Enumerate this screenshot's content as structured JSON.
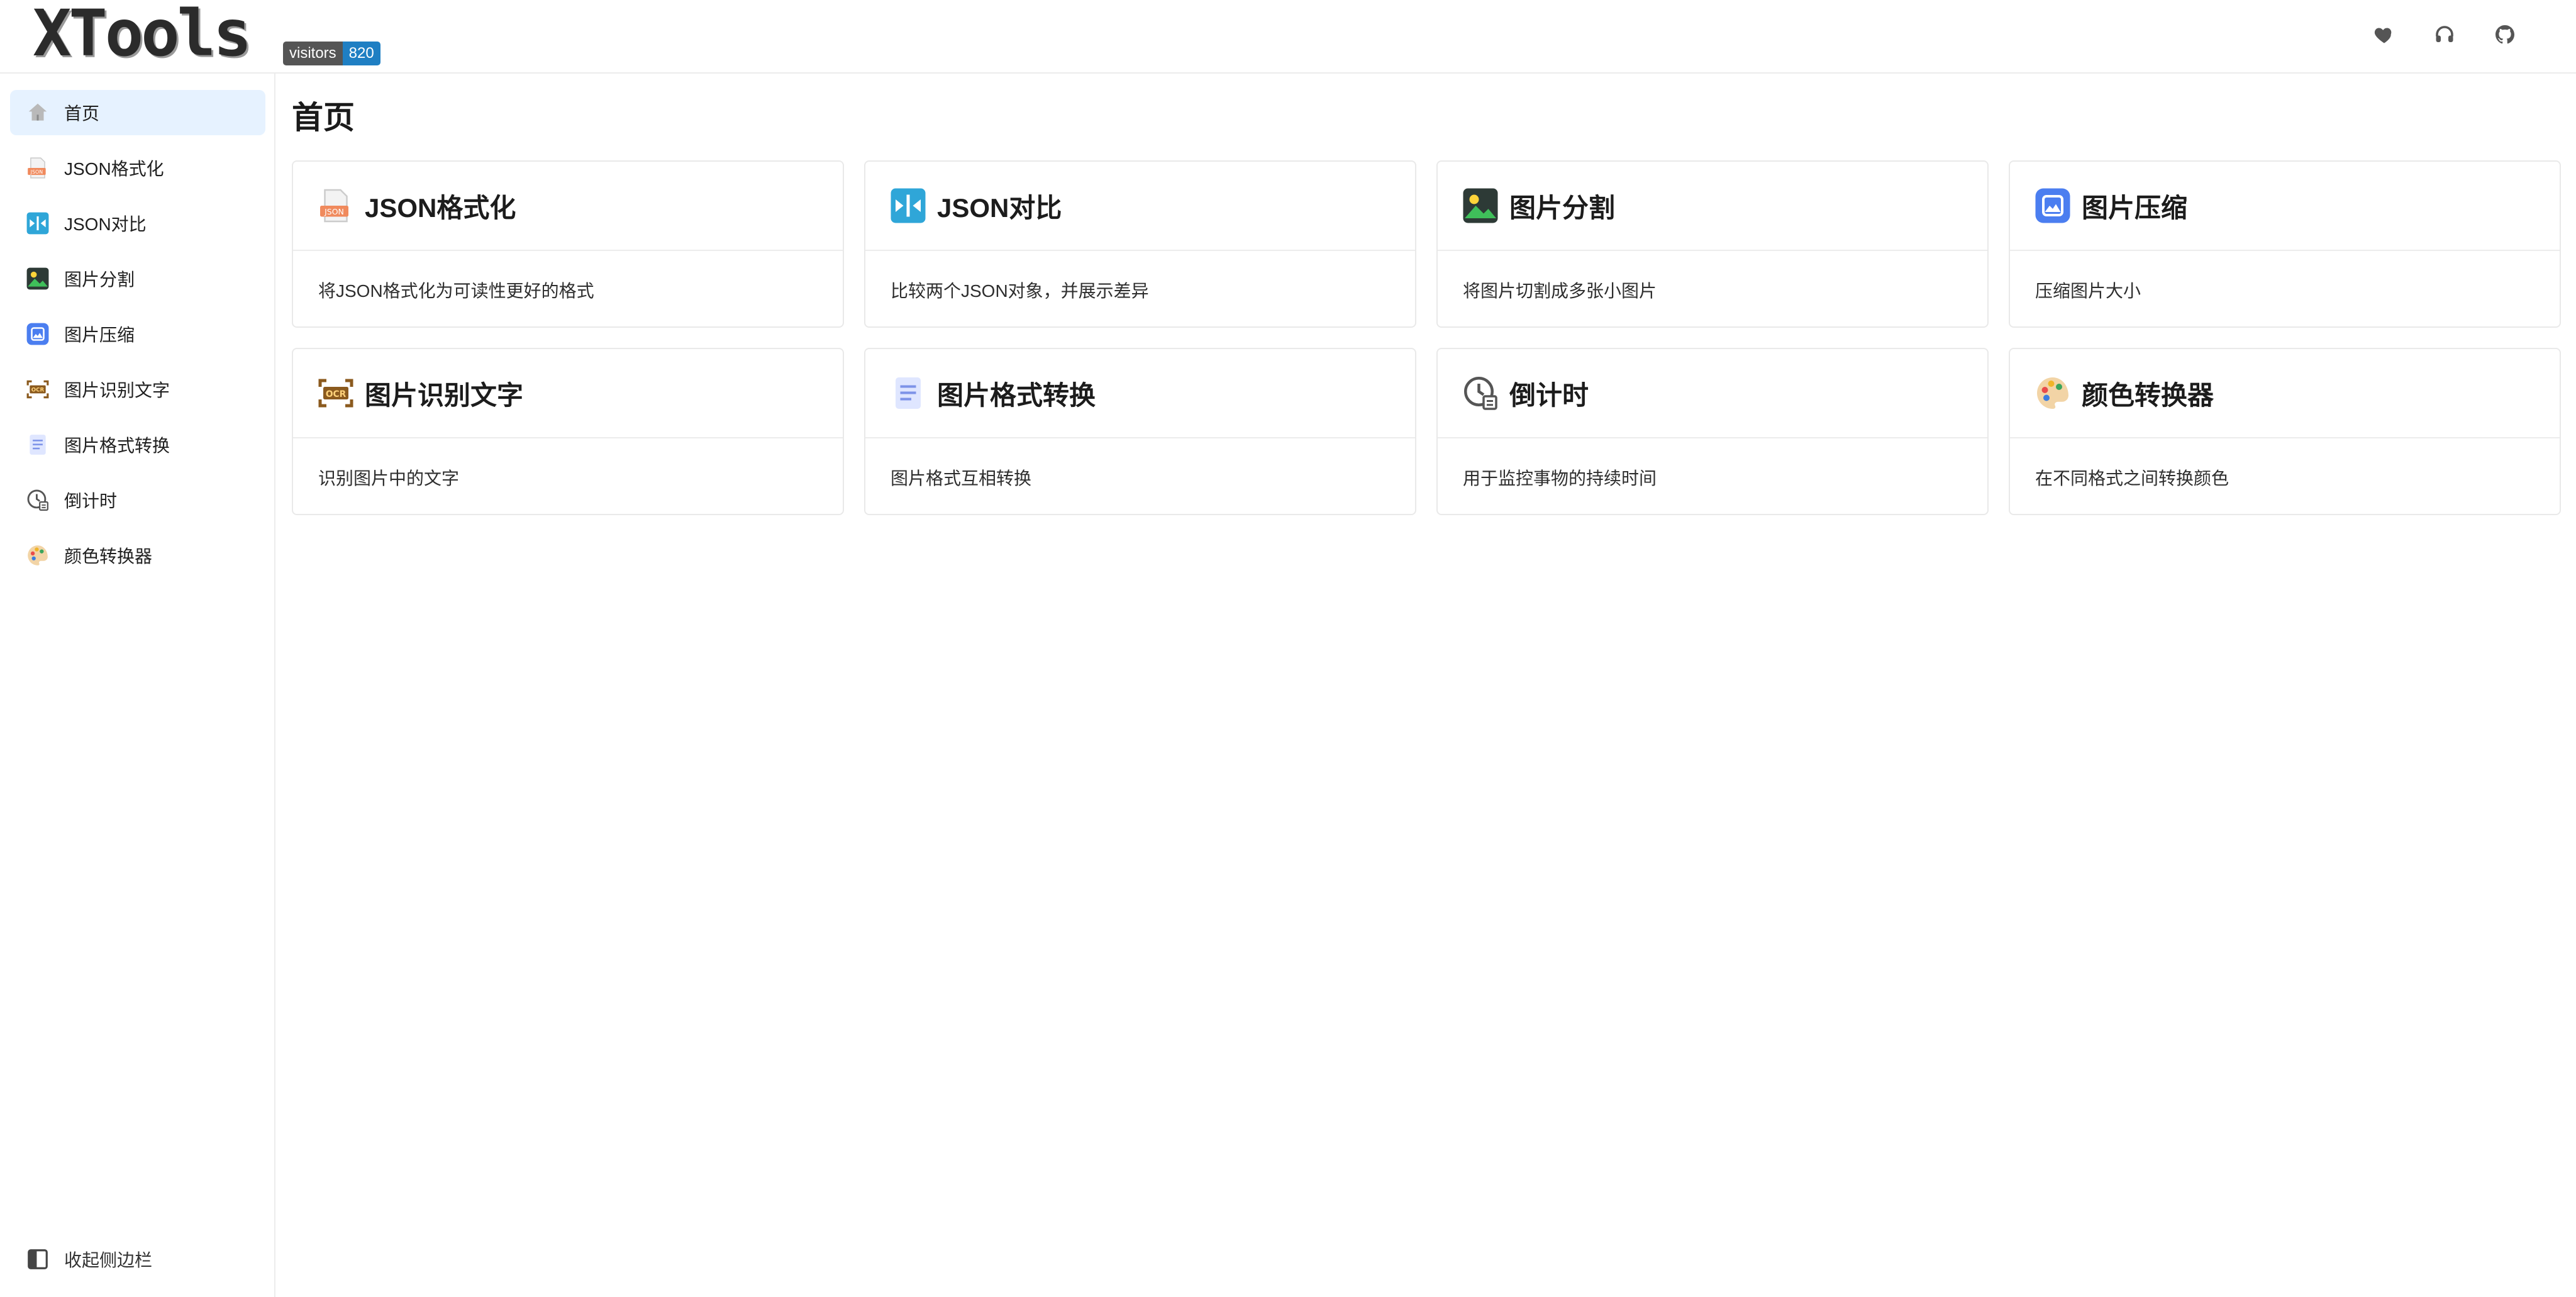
{
  "header": {
    "logo": "XTools",
    "badge": {
      "label": "visitors",
      "count": "820"
    },
    "icons": [
      "heart-icon",
      "headset-icon",
      "github-icon"
    ]
  },
  "sidebar": {
    "items": [
      {
        "label": "首页",
        "icon": "home-icon",
        "active": true
      },
      {
        "label": "JSON格式化",
        "icon": "json-file-icon"
      },
      {
        "label": "JSON对比",
        "icon": "compare-icon"
      },
      {
        "label": "图片分割",
        "icon": "image-split-icon"
      },
      {
        "label": "图片压缩",
        "icon": "image-compress-icon"
      },
      {
        "label": "图片识别文字",
        "icon": "ocr-icon"
      },
      {
        "label": "图片格式转换",
        "icon": "document-icon"
      },
      {
        "label": "倒计时",
        "icon": "clock-icon"
      },
      {
        "label": "颜色转换器",
        "icon": "palette-icon"
      }
    ],
    "collapse_label": "收起侧边栏"
  },
  "main": {
    "title": "首页",
    "cards": [
      {
        "title": "JSON格式化",
        "desc": "将JSON格式化为可读性更好的格式"
      },
      {
        "title": "JSON对比",
        "desc": "比较两个JSON对象，并展示差异"
      },
      {
        "title": "图片分割",
        "desc": "将图片切割成多张小图片"
      },
      {
        "title": "图片压缩",
        "desc": "压缩图片大小"
      },
      {
        "title": "图片识别文字",
        "desc": "识别图片中的文字"
      },
      {
        "title": "图片格式转换",
        "desc": "图片格式互相转换"
      },
      {
        "title": "倒计时",
        "desc": "用于监控事物的持续时间"
      },
      {
        "title": "颜色转换器",
        "desc": "在不同格式之间转换颜色"
      }
    ]
  },
  "colors": {
    "active_bg": "#e6f2ff",
    "badge_left": "#555555",
    "badge_right": "#1f7fc3",
    "border": "#e9e9e9"
  }
}
